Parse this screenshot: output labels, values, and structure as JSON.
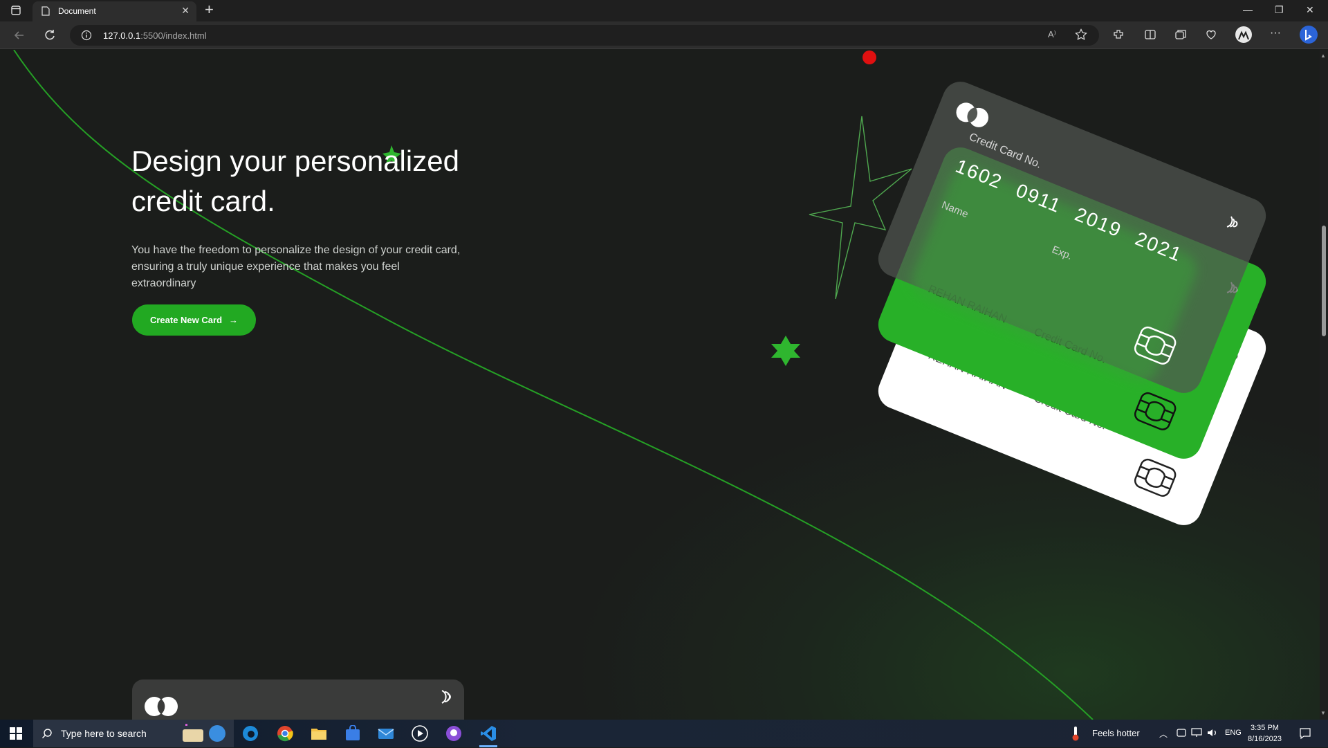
{
  "browser": {
    "tab_title": "Document",
    "url_host": "127.0.0.1",
    "url_path": ":5500/index.html"
  },
  "hero": {
    "title": "Design your personalized credit card.",
    "description": "You have the freedom to personalize the design of your credit card, ensuring a truly unique experience that makes you feel extraordinary",
    "cta_label": "Create New Card",
    "cta_arrow": "→"
  },
  "cards": {
    "glass": {
      "label": "Credit Card No.",
      "number": "1602 0911 2019 2021",
      "name_label": "Name",
      "exp_label": "Exp."
    },
    "green": {
      "holder": "REHAN RAIHAN",
      "label": "Credit Card No."
    },
    "white": {
      "holder": "REHAN RAIHAN",
      "label": "Credit Card No."
    }
  },
  "colors": {
    "accent": "#22a922",
    "background": "#1b1d1b",
    "card_green": "#28b028",
    "dot": "#e01010"
  },
  "taskbar": {
    "search_placeholder": "Type here to search",
    "weather": "Feels hotter",
    "language": "ENG",
    "time": "3:35 PM",
    "date": "8/16/2023"
  }
}
